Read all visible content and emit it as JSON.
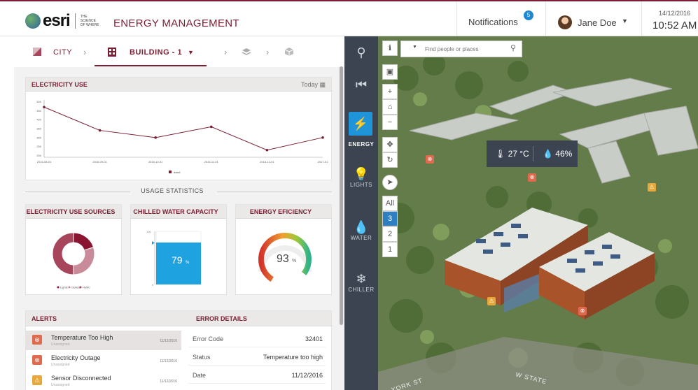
{
  "header": {
    "logo_text": "esri",
    "logo_tagline": "The Science of Where",
    "app_title": "ENERGY MANAGEMENT",
    "notifications_label": "Notifications",
    "notifications_count": "5",
    "user_name": "Jane Doe",
    "date": "14/12/2016",
    "time": "10:52 AM"
  },
  "breadcrumb": {
    "city": "CITY",
    "building": "BUILDING - 1"
  },
  "electricity_use": {
    "title": "ELECTRICITY USE",
    "period": "Today",
    "legend": "data1"
  },
  "chart_data": {
    "type": "line",
    "title": "ELECTRICITY USE",
    "x": [
      "2016-08-01",
      "2016-09-01",
      "2016-10-01",
      "2016-11-01",
      "2016-12-01",
      "2017-01"
    ],
    "series": [
      {
        "name": "data1",
        "values": [
          470,
          340,
          300,
          360,
          230,
          300
        ]
      }
    ],
    "y_ticks": [
      500,
      450,
      400,
      350,
      300,
      250,
      200
    ],
    "ylim": [
      190,
      510
    ],
    "color": "#7a1f33",
    "grid": false,
    "legend_position": "bottom-center"
  },
  "usage_statistics": {
    "label": "USAGE STATISTICS",
    "sources_title": "ELECTRICITY USE SOURCES",
    "sources_legend": [
      "Lights",
      "Outlets",
      "HVAC"
    ],
    "donut": [
      {
        "label": "Lights",
        "value": 20,
        "color": "#8a1530"
      },
      {
        "label": "Outlets",
        "value": 30,
        "color": "#c98a99"
      },
      {
        "label": "HVAC",
        "value": 50,
        "color": "#a7455c"
      }
    ],
    "chilled_title": "CHILLED WATER CAPACITY",
    "chilled_value": 79,
    "chilled_text": "79",
    "chilled_unit": "%",
    "chilled_top": "100",
    "chilled_bottom": "0",
    "efficiency_title": "ENERGY EFICIENCY",
    "efficiency_value": 93,
    "efficiency_text": "93",
    "efficiency_unit": "%"
  },
  "alerts": {
    "title": "ALERTS",
    "items": [
      {
        "title": "Temperature Too High",
        "sub": "Unassigned",
        "date": "11/12/2016",
        "icon": "error-icon",
        "color": "#e06a4e"
      },
      {
        "title": "Electricity Outage",
        "sub": "Unassigned",
        "date": "11/12/2016",
        "icon": "error-icon",
        "color": "#e06a4e"
      },
      {
        "title": "Sensor Disconnected",
        "sub": "Unassigned",
        "date": "11/12/2016",
        "icon": "warning-icon",
        "color": "#e6a83a"
      }
    ]
  },
  "error_details": {
    "title": "ERROR DETAILS",
    "rows": [
      {
        "key": "Error Code",
        "value": "32401"
      },
      {
        "key": "Status",
        "value": "Temperature too high"
      },
      {
        "key": "Date",
        "value": "11/12/2016"
      }
    ]
  },
  "sidebar": {
    "items": [
      {
        "label": "",
        "icon": "search-icon"
      },
      {
        "label": "",
        "icon": "collapse-icon"
      },
      {
        "label": "ENERGY",
        "icon": "lightning-icon"
      },
      {
        "label": "LIGHTS",
        "icon": "lightbulb-icon"
      },
      {
        "label": "WATER",
        "icon": "water-drops-icon"
      },
      {
        "label": "CHILLER",
        "icon": "snowflake-icon"
      }
    ]
  },
  "map": {
    "search_placeholder": "Find people or places",
    "floors": [
      "All",
      "3",
      "2",
      "1"
    ],
    "selected_floor": "3",
    "temperature": "27 °C",
    "humidity": "46%",
    "streets": [
      "YORK ST",
      "W STATE"
    ]
  }
}
